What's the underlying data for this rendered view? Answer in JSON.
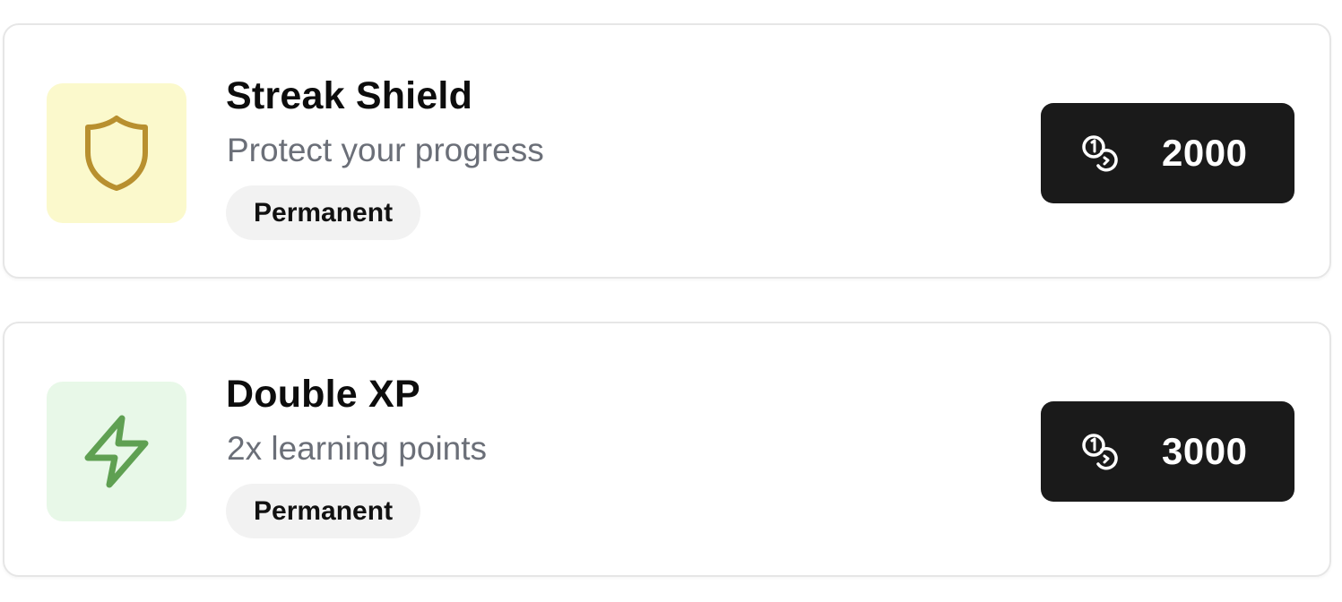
{
  "items": [
    {
      "title": "Streak Shield",
      "description": "Protect your progress",
      "badge": "Permanent",
      "price": "2000",
      "icon": "shield-icon",
      "icon_bg": "#fbf9cc",
      "icon_color": "#b8902f"
    },
    {
      "title": "Double XP",
      "description": "2x learning points",
      "badge": "Permanent",
      "price": "3000",
      "icon": "lightning-icon",
      "icon_bg": "#e8f8e8",
      "icon_color": "#5fa052"
    }
  ],
  "price_icon": "coins-icon",
  "colors": {
    "button_bg": "#1a1a1a",
    "button_text": "#ffffff",
    "badge_bg": "#f2f2f2",
    "subtitle": "#6b6f78"
  }
}
